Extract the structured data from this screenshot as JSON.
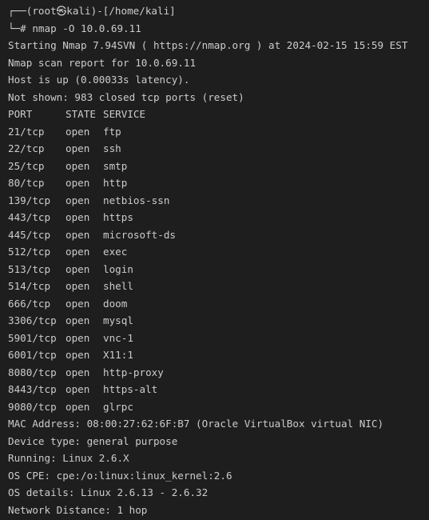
{
  "prompt": {
    "line1": "┌──(root㉿kali)-[/home/kali]",
    "line2": "└─# nmap -O 10.0.69.11"
  },
  "output": {
    "starting": "Starting Nmap 7.94SVN ( https://nmap.org ) at 2024-02-15 15:59 EST",
    "report": "Nmap scan report for 10.0.69.11",
    "host_up": "Host is up (0.00033s latency).",
    "not_shown": "Not shown: 983 closed tcp ports (reset)"
  },
  "ports_table": {
    "headers": {
      "port": "PORT",
      "state": "STATE",
      "service": "SERVICE"
    },
    "rows": [
      {
        "port": "21/tcp",
        "state": "open",
        "service": "ftp"
      },
      {
        "port": "22/tcp",
        "state": "open",
        "service": "ssh"
      },
      {
        "port": "25/tcp",
        "state": "open",
        "service": "smtp"
      },
      {
        "port": "80/tcp",
        "state": "open",
        "service": "http"
      },
      {
        "port": "139/tcp",
        "state": "open",
        "service": "netbios-ssn"
      },
      {
        "port": "443/tcp",
        "state": "open",
        "service": "https"
      },
      {
        "port": "445/tcp",
        "state": "open",
        "service": "microsoft-ds"
      },
      {
        "port": "512/tcp",
        "state": "open",
        "service": "exec"
      },
      {
        "port": "513/tcp",
        "state": "open",
        "service": "login"
      },
      {
        "port": "514/tcp",
        "state": "open",
        "service": "shell"
      },
      {
        "port": "666/tcp",
        "state": "open",
        "service": "doom"
      },
      {
        "port": "3306/tcp",
        "state": "open",
        "service": "mysql"
      },
      {
        "port": "5901/tcp",
        "state": "open",
        "service": "vnc-1"
      },
      {
        "port": "6001/tcp",
        "state": "open",
        "service": "X11:1"
      },
      {
        "port": "8080/tcp",
        "state": "open",
        "service": "http-proxy"
      },
      {
        "port": "8443/tcp",
        "state": "open",
        "service": "https-alt"
      },
      {
        "port": "9080/tcp",
        "state": "open",
        "service": "glrpc"
      }
    ]
  },
  "footer": {
    "mac": "MAC Address: 08:00:27:62:6F:B7 (Oracle VirtualBox virtual NIC)",
    "device_type": "Device type: general purpose",
    "running": "Running: Linux 2.6.X",
    "os_cpe": "OS CPE: cpe:/o:linux:linux_kernel:2.6",
    "os_details": "OS details: Linux 2.6.13 - 2.6.32",
    "network_distance": "Network Distance: 1 hop"
  },
  "colors": {
    "background": "#1e1e1e",
    "text": "#cccccc"
  }
}
